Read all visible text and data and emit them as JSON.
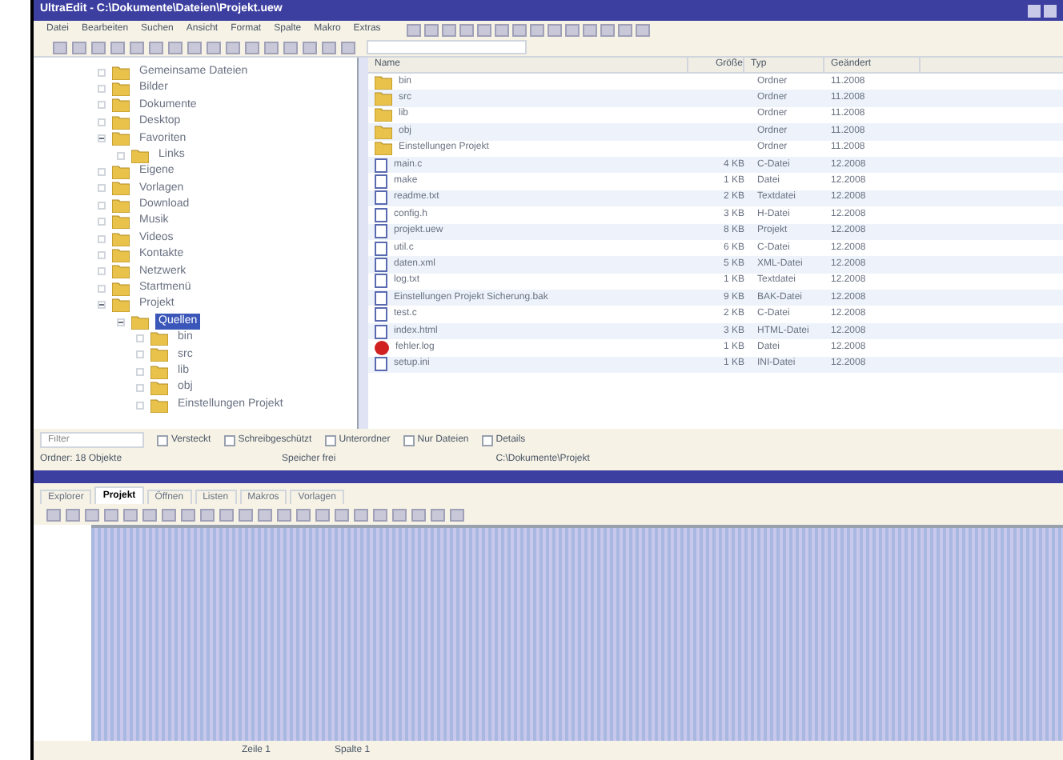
{
  "window": {
    "title": "UltraEdit - C:\\Dokumente\\Dateien\\Projekt.uew"
  },
  "menu": [
    "Datei",
    "Bearbeiten",
    "Suchen",
    "Ansicht",
    "Format",
    "Spalte",
    "Makro",
    "Extras"
  ],
  "tree": [
    {
      "label": "Gemeinsame Dateien",
      "expanded": false,
      "selected": false
    },
    {
      "label": "Bilder",
      "expanded": false,
      "selected": false
    },
    {
      "label": "Dokumente",
      "expanded": false,
      "selected": false
    },
    {
      "label": "Desktop",
      "expanded": false,
      "selected": false
    },
    {
      "label": "Favoriten",
      "expanded": true,
      "selected": false,
      "children": [
        {
          "label": "Links",
          "expanded": false,
          "selected": false
        }
      ]
    },
    {
      "label": "Eigene",
      "expanded": false,
      "selected": false
    },
    {
      "label": "Vorlagen",
      "expanded": false,
      "selected": false
    },
    {
      "label": "Download",
      "expanded": false,
      "selected": false
    },
    {
      "label": "Musik",
      "expanded": false,
      "selected": false
    },
    {
      "label": "Videos",
      "expanded": false,
      "selected": false
    },
    {
      "label": "Kontakte",
      "expanded": false,
      "selected": false
    },
    {
      "label": "Netzwerk",
      "expanded": false,
      "selected": false
    },
    {
      "label": "Startmenü",
      "expanded": false,
      "selected": false
    },
    {
      "label": "Projekt",
      "expanded": true,
      "selected": false,
      "children": [
        {
          "label": "Quellen",
          "expanded": true,
          "selected": true,
          "children": [
            {
              "label": "bin",
              "expanded": false,
              "selected": false
            },
            {
              "label": "src",
              "expanded": false,
              "selected": false
            },
            {
              "label": "lib",
              "expanded": false,
              "selected": false
            },
            {
              "label": "obj",
              "expanded": false,
              "selected": false
            },
            {
              "label": "Einstellungen Projekt",
              "expanded": false,
              "selected": false
            }
          ]
        }
      ]
    }
  ],
  "columns": [
    "Name",
    "Größe",
    "Typ",
    "Geändert"
  ],
  "files": [
    {
      "kind": "folder",
      "name": "bin",
      "type": "Ordner",
      "date": "11.2008"
    },
    {
      "kind": "folder",
      "name": "src",
      "type": "Ordner",
      "date": "11.2008"
    },
    {
      "kind": "folder",
      "name": "lib",
      "type": "Ordner",
      "date": "11.2008"
    },
    {
      "kind": "folder",
      "name": "obj",
      "type": "Ordner",
      "date": "11.2008"
    },
    {
      "kind": "folder",
      "name": "Einstellungen Projekt",
      "type": "Ordner",
      "date": "11.2008"
    },
    {
      "kind": "file",
      "name": "main.c",
      "size": "4 KB",
      "type": "C-Datei",
      "date": "12.2008"
    },
    {
      "kind": "file",
      "name": "make",
      "size": "1 KB",
      "type": "Datei",
      "date": "12.2008"
    },
    {
      "kind": "file",
      "name": "readme.txt",
      "size": "2 KB",
      "type": "Textdatei",
      "date": "12.2008"
    },
    {
      "kind": "file",
      "name": "config.h",
      "size": "3 KB",
      "type": "H-Datei",
      "date": "12.2008"
    },
    {
      "kind": "file",
      "name": "projekt.uew",
      "size": "8 KB",
      "type": "Projekt",
      "date": "12.2008"
    },
    {
      "kind": "file",
      "name": "util.c",
      "size": "6 KB",
      "type": "C-Datei",
      "date": "12.2008"
    },
    {
      "kind": "file",
      "name": "daten.xml",
      "size": "5 KB",
      "type": "XML-Datei",
      "date": "12.2008"
    },
    {
      "kind": "file",
      "name": "log.txt",
      "size": "1 KB",
      "type": "Textdatei",
      "date": "12.2008"
    },
    {
      "kind": "file",
      "name": "Einstellungen Projekt Sicherung.bak",
      "size": "9 KB",
      "type": "BAK-Datei",
      "date": "12.2008"
    },
    {
      "kind": "file",
      "name": "test.c",
      "size": "2 KB",
      "type": "C-Datei",
      "date": "12.2008"
    },
    {
      "kind": "file",
      "name": "index.html",
      "size": "3 KB",
      "type": "HTML-Datei",
      "date": "12.2008"
    },
    {
      "kind": "error",
      "name": "fehler.log",
      "size": "1 KB",
      "type": "Datei",
      "date": "12.2008"
    },
    {
      "kind": "file",
      "name": "setup.ini",
      "size": "1 KB",
      "type": "INI-Datei",
      "date": "12.2008"
    }
  ],
  "filter": {
    "placeholder": "Filter",
    "options": [
      {
        "label": "Versteckt",
        "checked": false
      },
      {
        "label": "Schreibgeschützt",
        "checked": false
      },
      {
        "label": "Unterordner",
        "checked": false
      },
      {
        "label": "Nur Dateien",
        "checked": false
      },
      {
        "label": "Details",
        "checked": false
      }
    ]
  },
  "status": [
    "Ordner: 18 Objekte",
    "Speicher frei",
    "C:\\Dokumente\\Projekt"
  ],
  "tabs": [
    {
      "label": "Explorer",
      "selected": false
    },
    {
      "label": "Projekt",
      "selected": true
    },
    {
      "label": "Öffnen",
      "selected": false
    },
    {
      "label": "Listen",
      "selected": false
    },
    {
      "label": "Makros",
      "selected": false
    },
    {
      "label": "Vorlagen",
      "selected": false
    }
  ],
  "bottom_status": [
    "Zeile 1",
    "Spalte 1"
  ]
}
